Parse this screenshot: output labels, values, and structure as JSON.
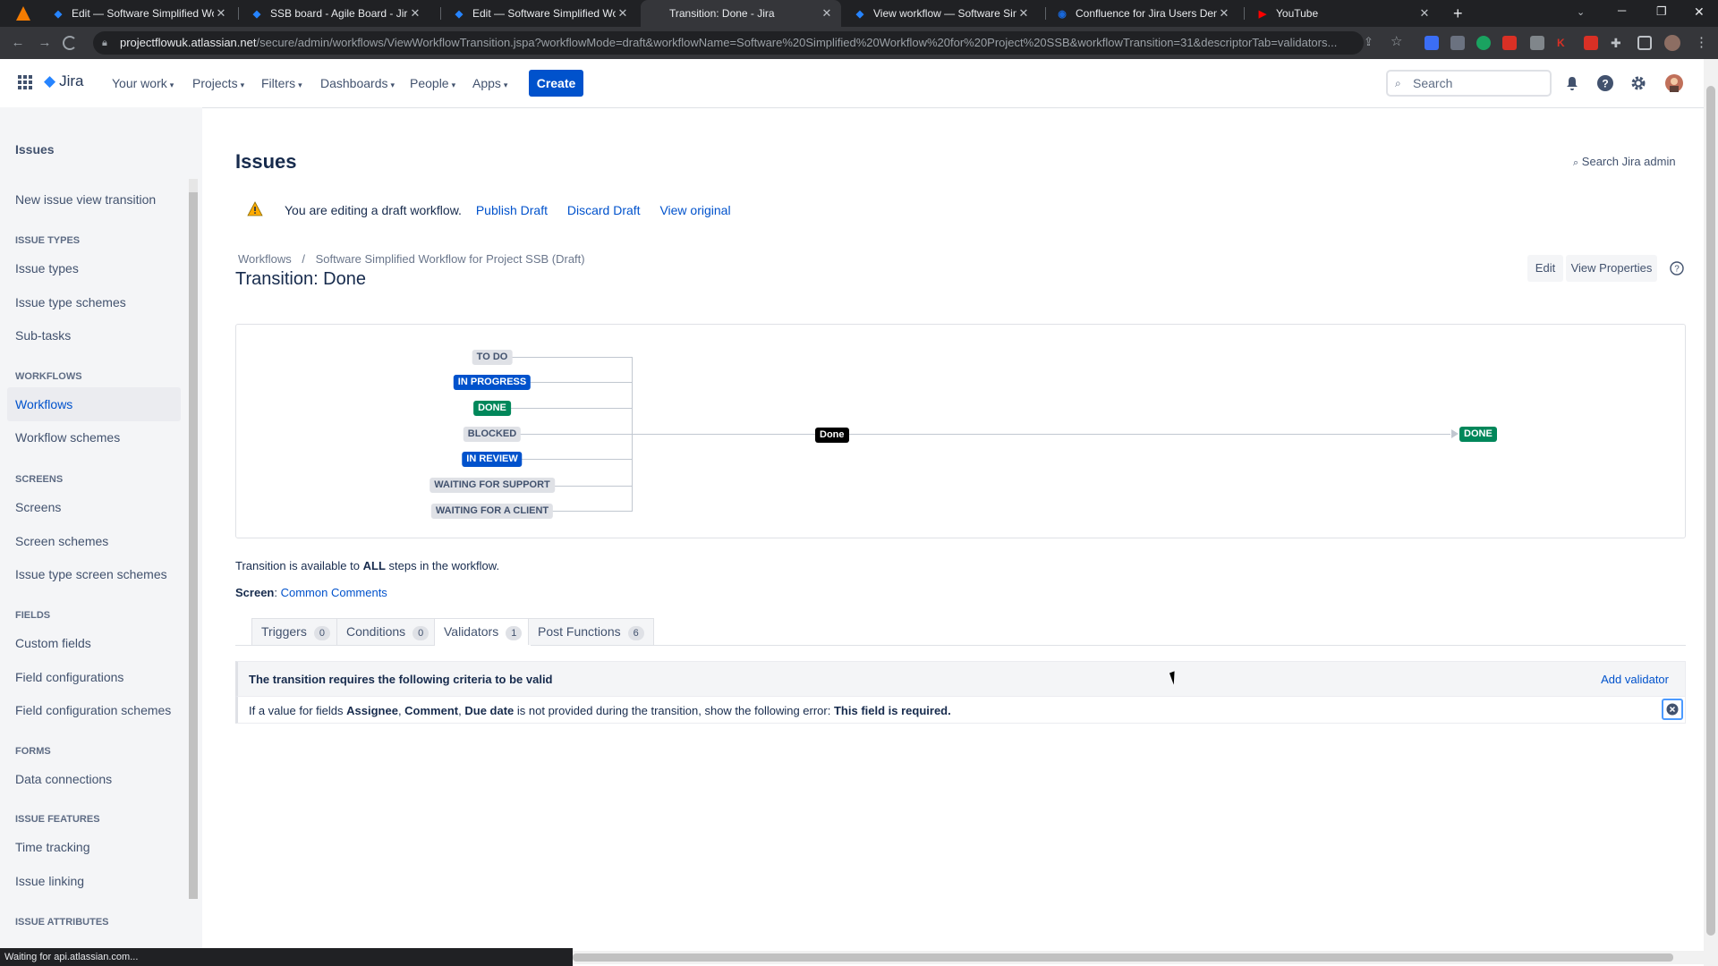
{
  "browser": {
    "tabs": [
      {
        "title": "Edit — Software Simplified Work",
        "icon": "jira-icon"
      },
      {
        "title": "SSB board - Agile Board - Jira",
        "icon": "jira-icon"
      },
      {
        "title": "Edit — Software Simplified Work",
        "icon": "jira-icon"
      },
      {
        "title": "Transition: Done - Jira",
        "icon": "none"
      },
      {
        "title": "View workflow — Software Simpl",
        "icon": "jira-icon"
      },
      {
        "title": "Confluence for Jira Users Demo \\",
        "icon": "confluence-icon"
      },
      {
        "title": "YouTube",
        "icon": "youtube-icon"
      }
    ],
    "url_host": "projectflowuk.atlassian.net",
    "url_path": "/secure/admin/workflows/ViewWorkflowTransition.jspa?workflowMode=draft&workflowName=Software%20Simplified%20Workflow%20for%20Project%20SSB&workflowTransition=31&descriptorTab=validators...",
    "status_text": "Waiting for api.atlassian.com..."
  },
  "header": {
    "product": "Jira",
    "nav": [
      "Your work",
      "Projects",
      "Filters",
      "Dashboards",
      "People",
      "Apps"
    ],
    "create_label": "Create",
    "search_placeholder": "Search"
  },
  "sidebar": {
    "title": "Issues",
    "top_item": "New issue view transition",
    "sections": [
      {
        "heading": "ISSUE TYPES",
        "items": [
          "Issue types",
          "Issue type schemes",
          "Sub-tasks"
        ]
      },
      {
        "heading": "WORKFLOWS",
        "items": [
          "Workflows",
          "Workflow schemes"
        ]
      },
      {
        "heading": "SCREENS",
        "items": [
          "Screens",
          "Screen schemes",
          "Issue type screen schemes"
        ]
      },
      {
        "heading": "FIELDS",
        "items": [
          "Custom fields",
          "Field configurations",
          "Field configuration schemes"
        ]
      },
      {
        "heading": "FORMS",
        "items": [
          "Data connections"
        ]
      },
      {
        "heading": "ISSUE FEATURES",
        "items": [
          "Time tracking",
          "Issue linking"
        ]
      },
      {
        "heading": "ISSUE ATTRIBUTES",
        "items": []
      }
    ],
    "selected": "Workflows"
  },
  "main": {
    "title": "Issues",
    "search_admin": "Search Jira admin",
    "draft_notice": "You are editing a draft workflow.",
    "publish_draft": "Publish Draft",
    "discard_draft": "Discard Draft",
    "view_original": "View original",
    "breadcrumb_root": "Workflows",
    "breadcrumb_sep": "/",
    "breadcrumb_leaf": "Software Simplified Workflow for Project SSB (Draft)",
    "page_title": "Transition: Done",
    "edit_label": "Edit",
    "view_properties_label": "View Properties",
    "diagram": {
      "from_statuses": [
        {
          "label": "TO DO",
          "color": "grey"
        },
        {
          "label": "IN PROGRESS",
          "color": "blue"
        },
        {
          "label": "DONE",
          "color": "green"
        },
        {
          "label": "BLOCKED",
          "color": "grey"
        },
        {
          "label": "IN REVIEW",
          "color": "blue"
        },
        {
          "label": "WAITING FOR SUPPORT",
          "color": "grey"
        },
        {
          "label": "WAITING FOR A CLIENT",
          "color": "grey"
        }
      ],
      "transition_label": "Done",
      "target_status": "DONE"
    },
    "availability_pre": "Transition is available to",
    "availability_bold": "ALL",
    "availability_post": "steps in the workflow.",
    "screen_label": "Screen",
    "screen_value": "Common Comments",
    "tabs": [
      {
        "label": "Triggers",
        "count": "0"
      },
      {
        "label": "Conditions",
        "count": "0"
      },
      {
        "label": "Validators",
        "count": "1"
      },
      {
        "label": "Post Functions",
        "count": "6"
      }
    ],
    "validators_header": "The transition requires the following criteria to be valid",
    "add_validator": "Add validator",
    "validator_row": {
      "pre": "If a value for fields",
      "f1": "Assignee",
      "f2": "Comment",
      "f3": "Due date",
      "mid": "is not provided during the transition, show the following error:",
      "error": "This field is required."
    }
  },
  "colors": {
    "accent": "#0052cc",
    "green": "#00875a",
    "grey_lozenge": "#dfe1e6"
  }
}
